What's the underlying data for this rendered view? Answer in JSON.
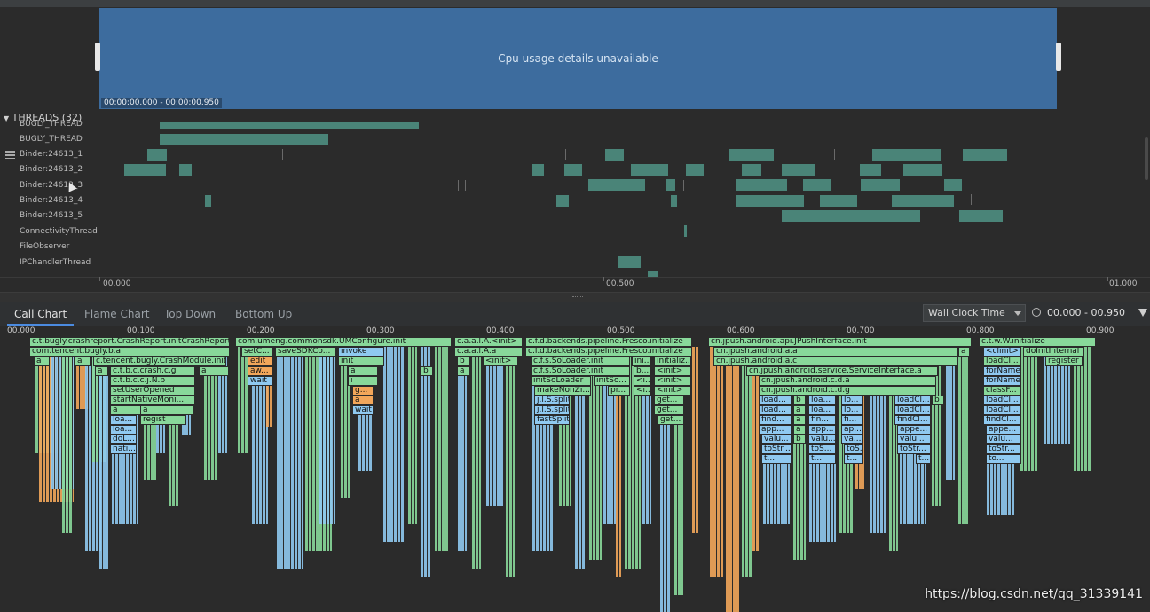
{
  "cpu": {
    "message": "Cpu usage details unavailable",
    "range": "00:00:00.000 - 00:00:00.950"
  },
  "threads": {
    "header": "THREADS (32)",
    "items": [
      {
        "label": "BUGLY_THREAD"
      },
      {
        "label": "BUGLY_THREAD"
      },
      {
        "label": "Binder:24613_1"
      },
      {
        "label": "Binder:24613_2"
      },
      {
        "label": "Binder:24613_3"
      },
      {
        "label": "Binder:24613_4"
      },
      {
        "label": "Binder:24613_5"
      },
      {
        "label": "ConnectivityThread"
      },
      {
        "label": "FileObserver"
      },
      {
        "label": "IPChandlerThread"
      }
    ]
  },
  "timeline_axis": {
    "labels": [
      "00.000",
      "00.500",
      "01.000"
    ]
  },
  "tabs": [
    {
      "label": "Call Chart",
      "active": true
    },
    {
      "label": "Flame Chart",
      "active": false
    },
    {
      "label": "Top Down",
      "active": false
    },
    {
      "label": "Bottom Up",
      "active": false
    }
  ],
  "clock_select": {
    "label": "Wall Clock Time"
  },
  "clock_range": "00.000 - 00.950",
  "callchart_axis": {
    "labels": [
      "00.000",
      "00.100",
      "00.200",
      "00.300",
      "00.400",
      "00.500",
      "00.600",
      "00.700",
      "00.800",
      "00.900"
    ]
  },
  "frames": {
    "crash_report": "c.t.bugly.crashreport.CrashReport.initCrashReport",
    "bugly_b_a": "com.tencent.bugly.b.a",
    "a1": "a",
    "a2": "a",
    "crash_module": "c.tencent.bugly.CrashModule.init",
    "crash_c_g": "c.t.b.c.crash.c.g",
    "a3": "a",
    "a4": "a",
    "c_j_n_b": "c.t.b.c.c.j.N.b",
    "set_user": "setUserOpened",
    "start_native": "startNativeMoni...",
    "a5": "a",
    "a6": "a",
    "loa1": "loa...",
    "regist": "regist",
    "loa2": "loa...",
    "do_l": "doL...",
    "nati": "nati...",
    "umconfig": "com.umeng.commonsdk.UMConfigure.init",
    "set_c": "setC...",
    "save_sdk": "saveSDKCo...",
    "invoke": "invoke",
    "edit": "edit",
    "init_u": "init",
    "aw": "aw...",
    "a7": "a",
    "b1": "b",
    "wait1": "wait",
    "i1": "i",
    "g1": "g...",
    "a8": "a",
    "wait2": "wait",
    "c_a_a_l": "c.a.a.l.A.<init>",
    "c_a_a_l2": "c.a.a.l.A.a",
    "b2": "b",
    "a9": "a",
    "init2": "<init>",
    "fresco1": "c.f.d.backends.pipeline.Fresco.initialize",
    "fresco2": "c.f.d.backends.pipeline.Fresco.initialize",
    "so_loader1": "c.f.s.SoLoader.init",
    "ini": "ini...",
    "initializ": "initializ...",
    "so_loader2": "c.f.s.SoLoader.init",
    "b3": "b...",
    "init3": "<init>",
    "init_so": "initSoLoader",
    "init_so2": "initSo...",
    "lt1": "<i...",
    "init4": "<init>",
    "make_non": "makeNonZi...",
    "pr": "pr...",
    "lt2": "<i...",
    "init5": "<init>",
    "jls1": "j.l.S.split",
    "get1": "get...",
    "jls2": "j.l.S.split",
    "get2": "get...",
    "fast_split": "fastSplit",
    "get3": "get...",
    "jpush_init": "cn.jpush.android.api.JPushInterface.init",
    "jpush_a_a": "cn.jpush.android.a.a",
    "jpush_a_c": "cn.jpush.android.a.c",
    "service_interface": "cn.jpush.android.service.ServiceInterface.a",
    "jpush_cda": "cn.jpush.android.c.d.a",
    "jpush_cdg": "cn.jpush.android.c.d.g",
    "a10": "a",
    "b4": "b",
    "load1": "load...",
    "b5": "b",
    "loa3": "loa...",
    "lo1": "lo...",
    "load_cl1": "loadCl...",
    "b6": "b",
    "load2": "load...",
    "a11": "a",
    "loa4": "loa...",
    "lo2": "lo...",
    "load_cl2": "loadCl...",
    "find1": "find...",
    "a12": "a",
    "fin1": "fin...",
    "fi1": "fi...",
    "find_cl1": "findCl...",
    "app1": "app...",
    "a13": "a",
    "app2": "app...",
    "ap1": "ap...",
    "appe1": "appe...",
    "valu1": "valu...",
    "b7": "b",
    "valu2": "valu...",
    "va1": "va...",
    "valu3": "valu...",
    "to_str1": "toStr...",
    "to_s1": "toS...",
    "to_s2": "toS...",
    "to_str2": "toStr...",
    "t1": "t...",
    "t2": "t...",
    "t3": "t...",
    "t4": "t...",
    "ctw_init": "c.t.w.W.initialize",
    "clinit": "<clinit>",
    "do_init_internal": "doInitInternal",
    "load_cl3": "loadCl...",
    "register": "register",
    "for_name1": "forName",
    "for_name2": "forName",
    "class_f": "classF...",
    "load_cl4": "loadCl...",
    "load_cl5": "loadCl...",
    "find_cl2": "findCl...",
    "appe2": "appe...",
    "valu4": "valu...",
    "to_str3": "toStr...",
    "to1": "to..."
  },
  "watermark": "https://blog.csdn.net/qq_31339141",
  "colors": {
    "cpu_selection": "#3d6c9e",
    "thread_bar": "#4a8478",
    "frame_green": "#88d89a",
    "frame_blue": "#8fc9f0",
    "frame_orange": "#f2a65a"
  }
}
